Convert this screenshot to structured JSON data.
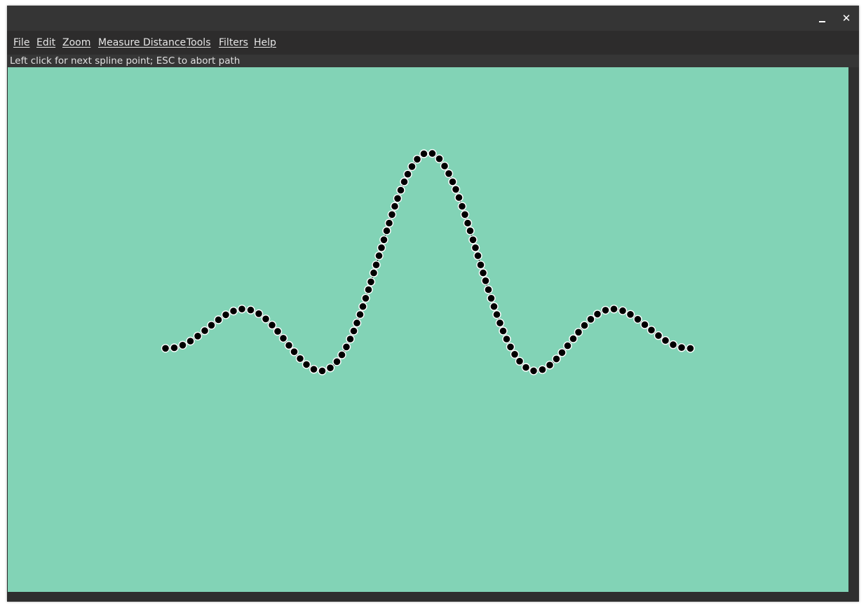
{
  "window": {
    "minimize_icon": "minimize-icon",
    "close_icon": "close-icon",
    "close_glyph": "✕"
  },
  "menu": {
    "items": [
      {
        "label": "File"
      },
      {
        "label": "Edit"
      },
      {
        "label": "Zoom"
      },
      {
        "label": "Measure Distance"
      },
      {
        "label": "Tools"
      },
      {
        "label": "Filters"
      },
      {
        "label": "Help"
      }
    ]
  },
  "status": {
    "text": "Left click for next spline point; ESC to abort path"
  },
  "canvas": {
    "background": "#82d3b6",
    "curve_color": "#000000",
    "point_fill": "#000000",
    "point_outline": "#ffffff",
    "curve": "sinc-shaped spline path with control points"
  }
}
